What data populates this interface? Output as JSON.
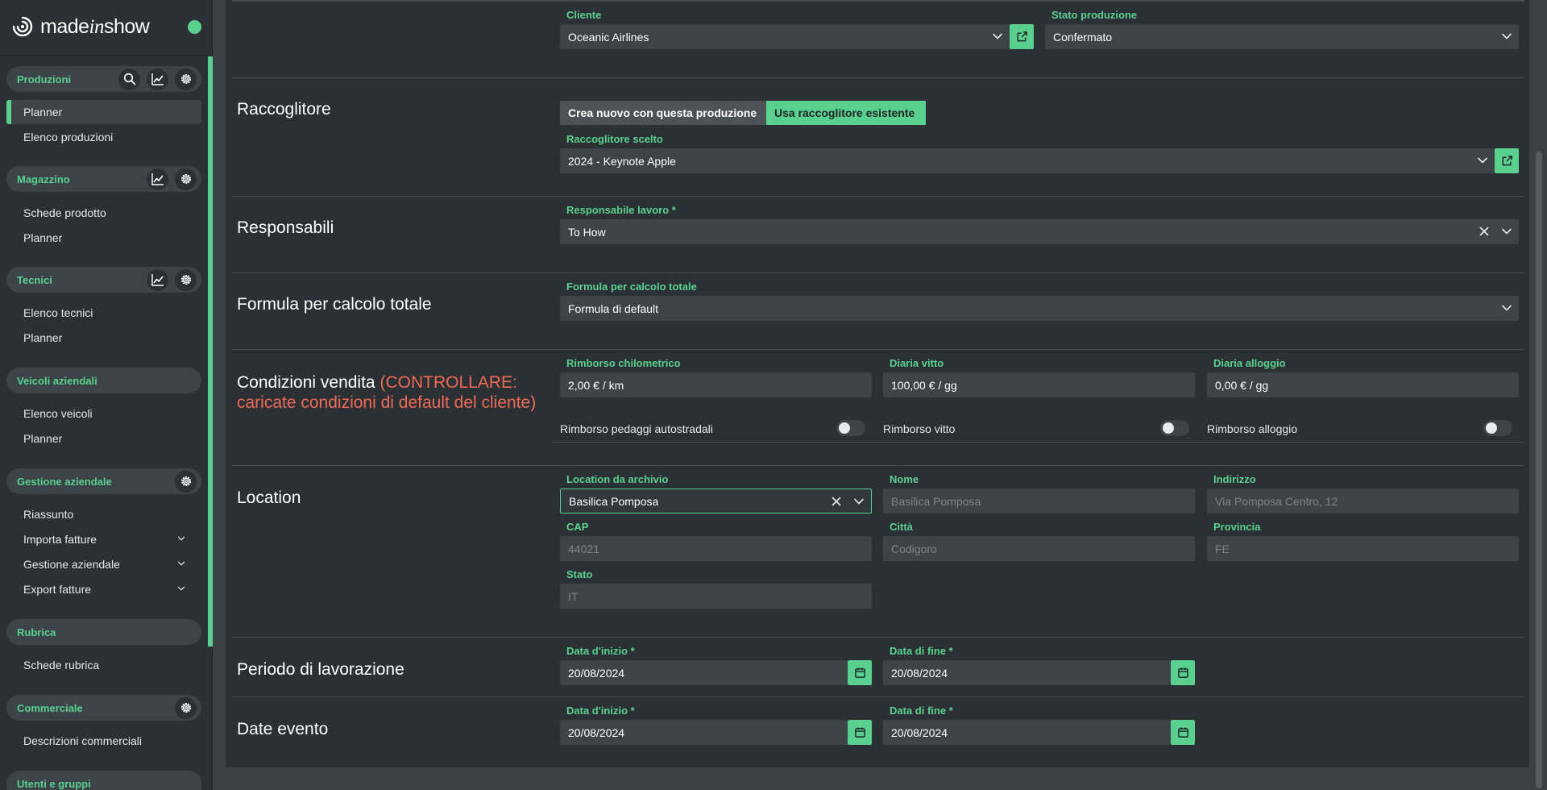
{
  "app": {
    "logo_prefix": "made",
    "logo_italic": "in",
    "logo_suffix": "show"
  },
  "sidebar": {
    "produzioni": {
      "title": "Produzioni",
      "items": [
        "Planner",
        "Elenco produzioni"
      ]
    },
    "magazzino": {
      "title": "Magazzino",
      "items": [
        "Schede prodotto",
        "Planner"
      ]
    },
    "tecnici": {
      "title": "Tecnici",
      "items": [
        "Elenco tecnici",
        "Planner"
      ]
    },
    "veicoli": {
      "title": "Veicoli aziendali",
      "items": [
        "Elenco veicoli",
        "Planner"
      ]
    },
    "gestione": {
      "title": "Gestione aziendale",
      "items": [
        "Riassunto",
        "Importa fatture",
        "Gestione aziendale",
        "Export fatture"
      ]
    },
    "rubrica": {
      "title": "Rubrica",
      "items": [
        "Schede rubrica"
      ]
    },
    "commerciale": {
      "title": "Commerciale",
      "items": [
        "Descrizioni commerciali"
      ]
    },
    "utenti": {
      "title": "Utenti e gruppi"
    }
  },
  "form": {
    "cliente": {
      "label": "Cliente",
      "value": "Oceanic Airlines"
    },
    "stato_produzione": {
      "label": "Stato produzione",
      "value": "Confermato"
    },
    "raccoglitore": {
      "title": "Raccoglitore",
      "btn_new": "Crea nuovo con questa produzione",
      "btn_existing": "Usa raccoglitore esistente",
      "label": "Raccoglitore scelto",
      "value": "2024 - Keynote Apple"
    },
    "responsabili": {
      "title": "Responsabili",
      "label": "Responsabile lavoro *",
      "value": "To How"
    },
    "formula": {
      "title": "Formula per calcolo totale",
      "label": "Formula per calcolo totale",
      "value": "Formula di default"
    },
    "condizioni": {
      "title": "Condizioni vendita",
      "warning_line1": "(CONTROLLARE:",
      "warning_line2": "caricate condizioni di default del cliente)",
      "rimborso_km": {
        "label": "Rimborso chilometrico",
        "value": "2,00 € / km"
      },
      "diaria_vitto": {
        "label": "Diaria vitto",
        "value": "100,00 € / gg"
      },
      "diaria_alloggio": {
        "label": "Diaria alloggio",
        "value": "0,00 € / gg"
      },
      "toggle_pedaggi": {
        "label": "Rimborso pedaggi autostradali",
        "on": false
      },
      "toggle_vitto": {
        "label": "Rimborso vitto",
        "on": false
      },
      "toggle_alloggio": {
        "label": "Rimborso alloggio",
        "on": false
      }
    },
    "location": {
      "title": "Location",
      "archivio": {
        "label": "Location da archivio",
        "value": "Basilica Pomposa"
      },
      "nome": {
        "label": "Nome",
        "value": "Basilica Pomposa"
      },
      "indirizzo": {
        "label": "Indirizzo",
        "value": "Via Pomposa Centro, 12"
      },
      "cap": {
        "label": "CAP",
        "value": "44021"
      },
      "citta": {
        "label": "Città",
        "value": "Codigoro"
      },
      "provincia": {
        "label": "Provincia",
        "value": "FE"
      },
      "stato": {
        "label": "Stato",
        "value": "IT"
      }
    },
    "periodo": {
      "title": "Periodo di lavorazione",
      "inizio": {
        "label": "Data d'inizio *",
        "value": "20/08/2024"
      },
      "fine": {
        "label": "Data di fine *",
        "value": "20/08/2024"
      }
    },
    "date_evento": {
      "title": "Date evento",
      "inizio": {
        "label": "Data d'inizio *",
        "value": "20/08/2024"
      },
      "fine": {
        "label": "Data di fine *",
        "value": "20/08/2024"
      }
    }
  },
  "colors": {
    "accent": "#5ad08f",
    "warning": "#ef6a57",
    "panel": "#2b3034",
    "field": "#3c4349"
  }
}
